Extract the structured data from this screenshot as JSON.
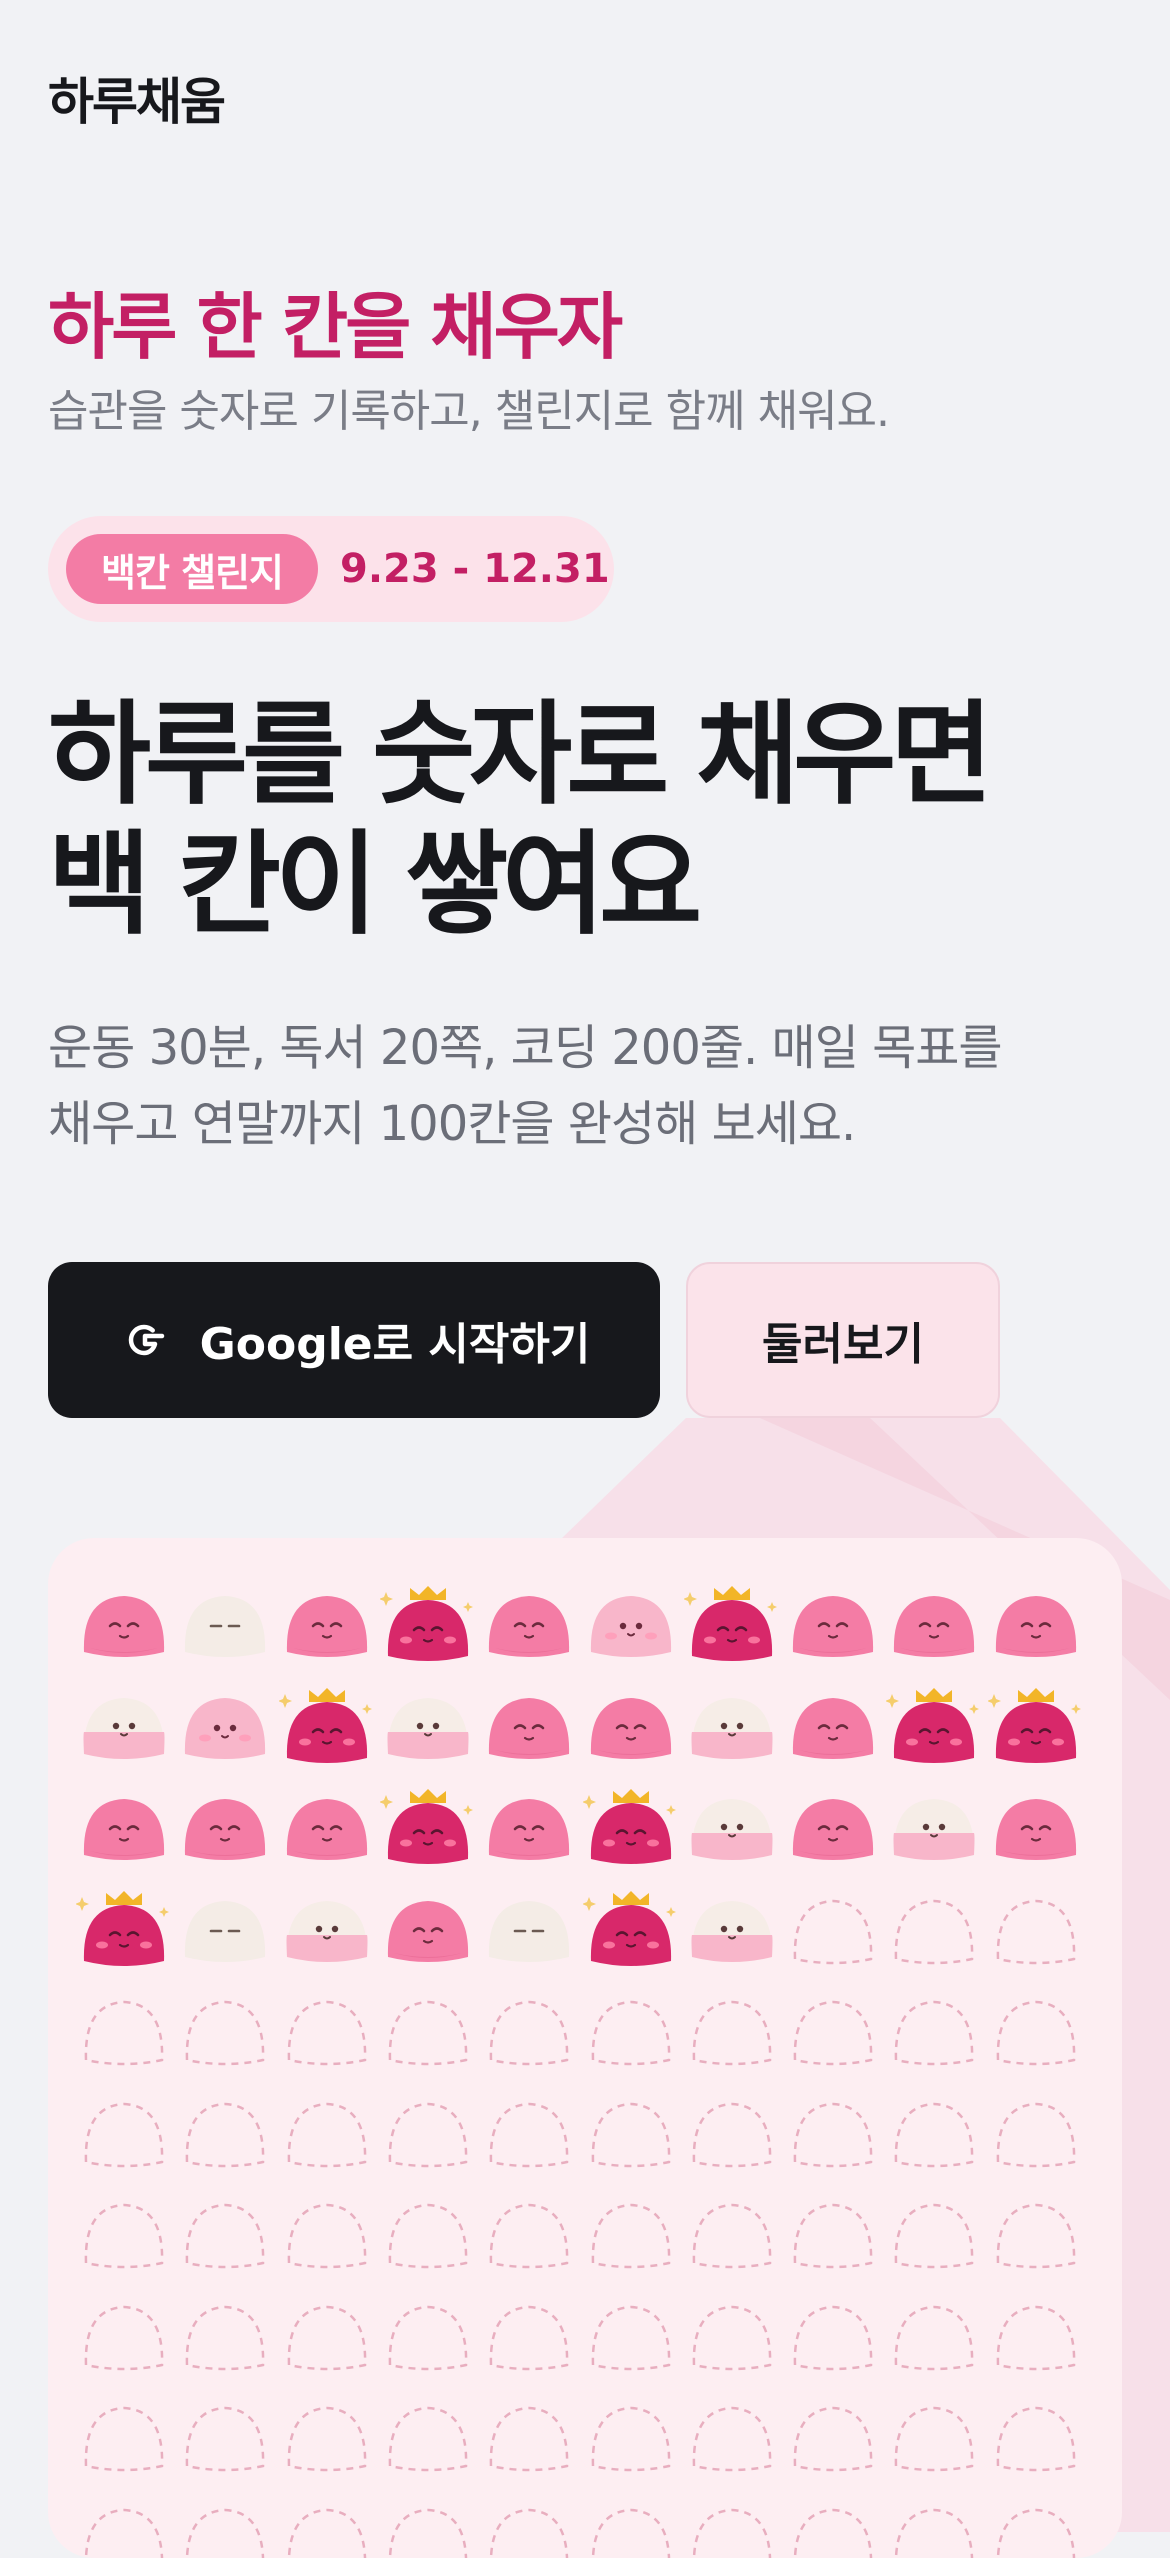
{
  "header": {
    "logo": "하루채움"
  },
  "hero": {
    "subtitle": "하루 한 칸을 채우자",
    "description": "습관을 숫자로 기록하고, 챌린지로 함께 채워요.",
    "challenge_badge": "백칸 챌린지",
    "challenge_dates": "9.23 - 12.31",
    "headline_line1": "하루를 숫자로 채우면",
    "headline_line2": "백 칸이 쌓여요",
    "body_line1": "운동 30분, 독서 20쪽, 코딩 200줄. 매일 목표를",
    "body_line2": "채우고 연말까지 100칸을 완성해 보세요."
  },
  "actions": {
    "google_start": "Google로 시작하기",
    "browse": "둘러보기"
  },
  "colors": {
    "accent": "#c31f64",
    "badge_pink": "#f37ca5",
    "dark_button": "#17181c",
    "board_bg": "#fdeef2"
  },
  "board": {
    "columns": 10,
    "total_cells": 100,
    "filled_cells": 37,
    "cells": [
      "pink",
      "white",
      "pink",
      "crown",
      "pink",
      "light",
      "crown",
      "pink",
      "pink",
      "pink",
      "half",
      "light",
      "crown",
      "half",
      "pink",
      "pink",
      "half",
      "pink",
      "crown",
      "crown",
      "pink",
      "pink",
      "pink",
      "crown",
      "pink",
      "crown",
      "half",
      "pink",
      "half",
      "pink",
      "crown",
      "white",
      "half",
      "pink",
      "white",
      "crown",
      "half"
    ]
  }
}
